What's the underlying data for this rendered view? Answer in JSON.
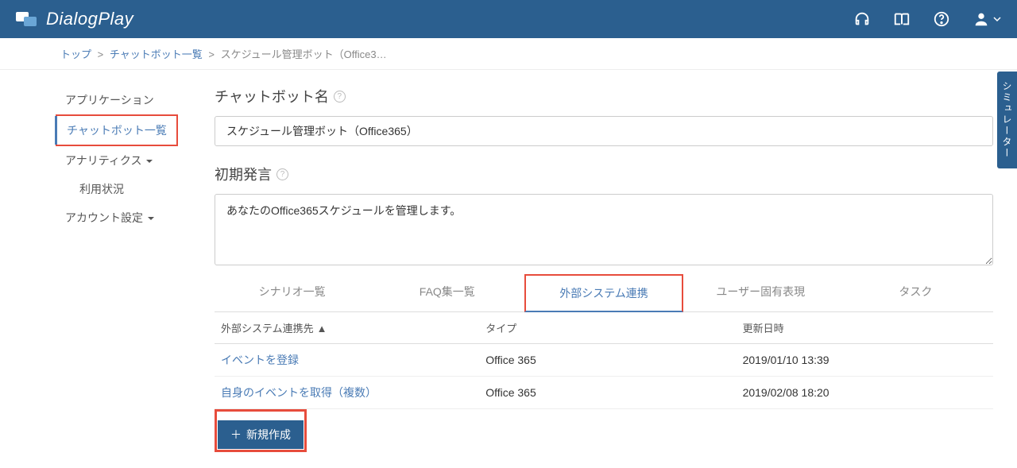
{
  "header": {
    "brand": "DialogPlay"
  },
  "breadcrumb": {
    "top": "トップ",
    "chatbot_list": "チャットボット一覧",
    "current": "スケジュール管理ボット（Office3…"
  },
  "sidebar": {
    "application": "アプリケーション",
    "chatbot_list": "チャットボット一覧",
    "analytics": "アナリティクス",
    "usage": "利用状況",
    "account_settings": "アカウント設定"
  },
  "main": {
    "name_label": "チャットボット名",
    "name_value": "スケジュール管理ボット（Office365）",
    "initial_label": "初期発言",
    "initial_value": "あなたのOffice365スケジュールを管理します。"
  },
  "tabs": {
    "scenarios": "シナリオ一覧",
    "faq": "FAQ集一覧",
    "external": "外部システム連携",
    "user_expr": "ユーザー固有表現",
    "task": "タスク"
  },
  "table": {
    "headers": {
      "dest": "外部システム連携先",
      "type": "タイプ",
      "updated": "更新日時"
    },
    "rows": [
      {
        "dest": "イベントを登録",
        "type": "Office 365",
        "updated": "2019/01/10 13:39"
      },
      {
        "dest": "自身のイベントを取得（複数）",
        "type": "Office 365",
        "updated": "2019/02/08 18:20"
      }
    ]
  },
  "buttons": {
    "create": "新規作成"
  },
  "simulator_tab": "シミュレーター"
}
